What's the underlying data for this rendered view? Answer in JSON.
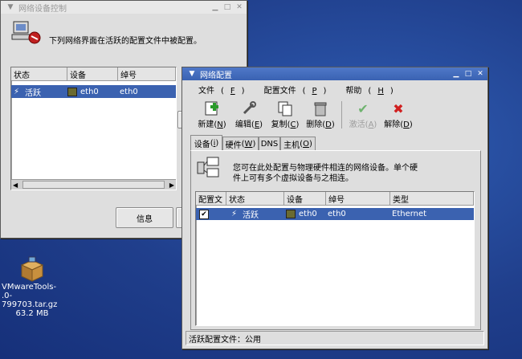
{
  "desktop": {
    "icon_label_line1": "VMwareTools-",
    "icon_label_line2": ".0-799703.tar.gz",
    "icon_size": "63.2 MB"
  },
  "back_window": {
    "title": "网络设备控制",
    "message": "下列网络界面在活跃的配置文件中被配置。",
    "columns": [
      "状态",
      "设备",
      "绰号"
    ],
    "row": {
      "status": "活跃",
      "device": "eth0",
      "nickname": "eth0"
    },
    "info_button": "信息"
  },
  "front_window": {
    "title": "网络配置",
    "menu": [
      {
        "label": "文件",
        "key": "F"
      },
      {
        "label": "配置文件",
        "key": "P"
      },
      {
        "label": "帮助",
        "key": "H"
      }
    ],
    "toolbar": [
      {
        "label": "新建",
        "key": "N",
        "icon": "new-icon",
        "disabled": false
      },
      {
        "label": "编辑",
        "key": "E",
        "icon": "edit-icon",
        "disabled": false
      },
      {
        "label": "复制",
        "key": "C",
        "icon": "copy-icon",
        "disabled": false
      },
      {
        "label": "删除",
        "key": "D",
        "icon": "delete-icon",
        "disabled": false
      },
      {
        "label": "激活",
        "key": "A",
        "icon": "activate-icon",
        "disabled": true
      },
      {
        "label": "解除",
        "key": "D",
        "icon": "deactivate-icon",
        "disabled": false
      }
    ],
    "tabs": [
      {
        "label": "设备",
        "key": "i"
      },
      {
        "label": "硬件",
        "key": "W"
      },
      {
        "label": "DNS",
        "key": ""
      },
      {
        "label": "主机",
        "key": "O"
      }
    ],
    "description_line1": "您可在此处配置与物理硬件相连的网络设备。单个硬",
    "description_line2": "件上可有多个虚拟设备与之相连。",
    "columns": [
      "配置文",
      "状态",
      "设备",
      "绰号",
      "类型"
    ],
    "row": {
      "status": "活跃",
      "device": "eth0",
      "nickname": "eth0",
      "type": "Ethernet"
    },
    "statusbar": "活跃配置文件：公用"
  },
  "colors": {
    "selection": "#3b62b0",
    "titlebar_active": "#4a72c2",
    "desktop": "#1f3f8a"
  }
}
